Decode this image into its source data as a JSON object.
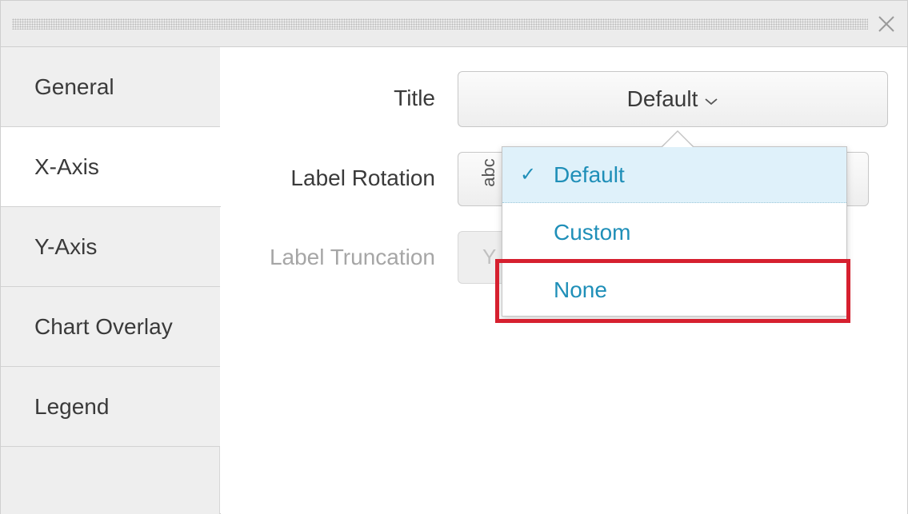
{
  "dialog": {
    "close_icon": "close-icon"
  },
  "sidebar": {
    "items": [
      {
        "label": "General",
        "active": false
      },
      {
        "label": "X-Axis",
        "active": true
      },
      {
        "label": "Y-Axis",
        "active": false
      },
      {
        "label": "Chart Overlay",
        "active": false
      },
      {
        "label": "Legend",
        "active": false
      }
    ]
  },
  "form": {
    "title_label": "Title",
    "title_value": "Default",
    "label_rotation_label": "Label Rotation",
    "label_rotation_glyph": "abc",
    "label_truncation_label": "Label Truncation",
    "label_truncation_glyph": "Y"
  },
  "dropdown": {
    "items": [
      {
        "label": "Default",
        "selected": true,
        "check": "✓"
      },
      {
        "label": "Custom",
        "selected": false
      },
      {
        "label": "None",
        "selected": false,
        "highlighted": true
      }
    ]
  },
  "colors": {
    "accent": "#1f8fb8",
    "highlight_border": "#d6202f",
    "selected_bg": "#dff1fa"
  }
}
